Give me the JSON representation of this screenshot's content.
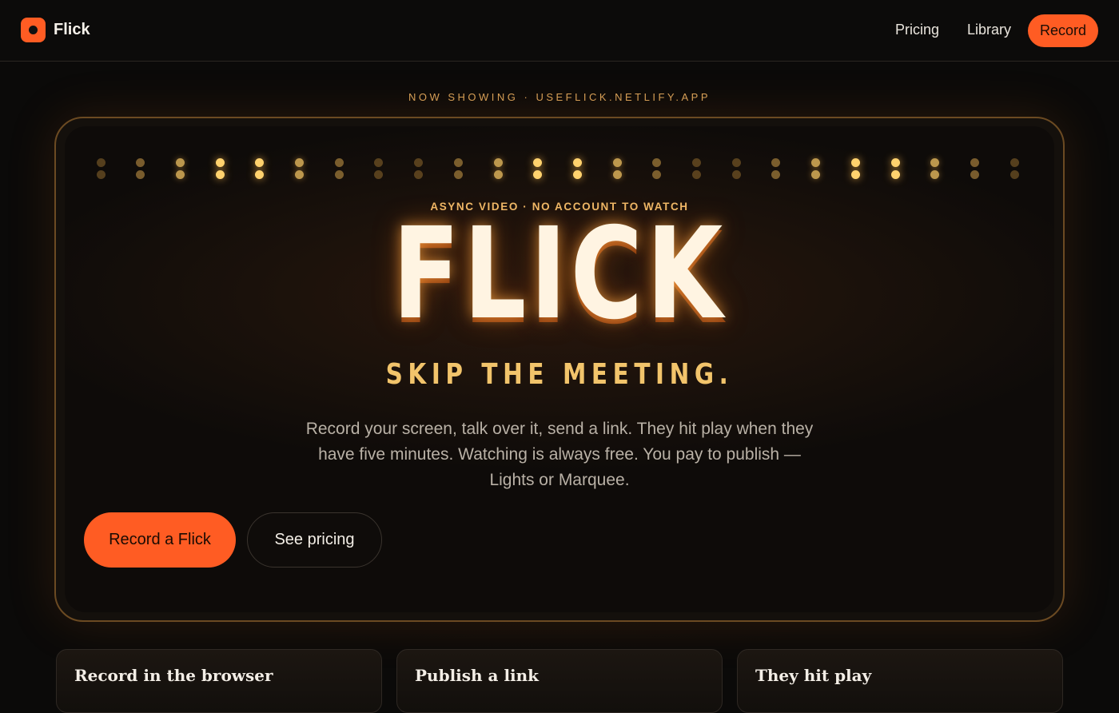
{
  "nav": {
    "brand": "Flick",
    "links": [
      {
        "label": "Pricing"
      },
      {
        "label": "Library"
      }
    ],
    "record_label": "Record"
  },
  "hero": {
    "eyebrow": "NOW SHOWING · USEFLICK.NETLIFY.APP",
    "kicker": "ASYNC VIDEO · NO ACCOUNT TO WATCH",
    "title": "FLICK",
    "tagline": "SKIP THE MEETING.",
    "lede": "Record your screen, talk over it, send a link. They hit play when they have five minutes. Watching is always free. You pay to publish — Lights or Marquee.",
    "cta_primary": "Record a Flick",
    "cta_secondary": "See pricing"
  },
  "features": [
    {
      "title": "Record in the browser"
    },
    {
      "title": "Publish a link"
    },
    {
      "title": "They hit play"
    }
  ],
  "colors": {
    "accent": "#ff5c23",
    "marquee_gold": "#efb867",
    "background": "#0b0a09"
  }
}
